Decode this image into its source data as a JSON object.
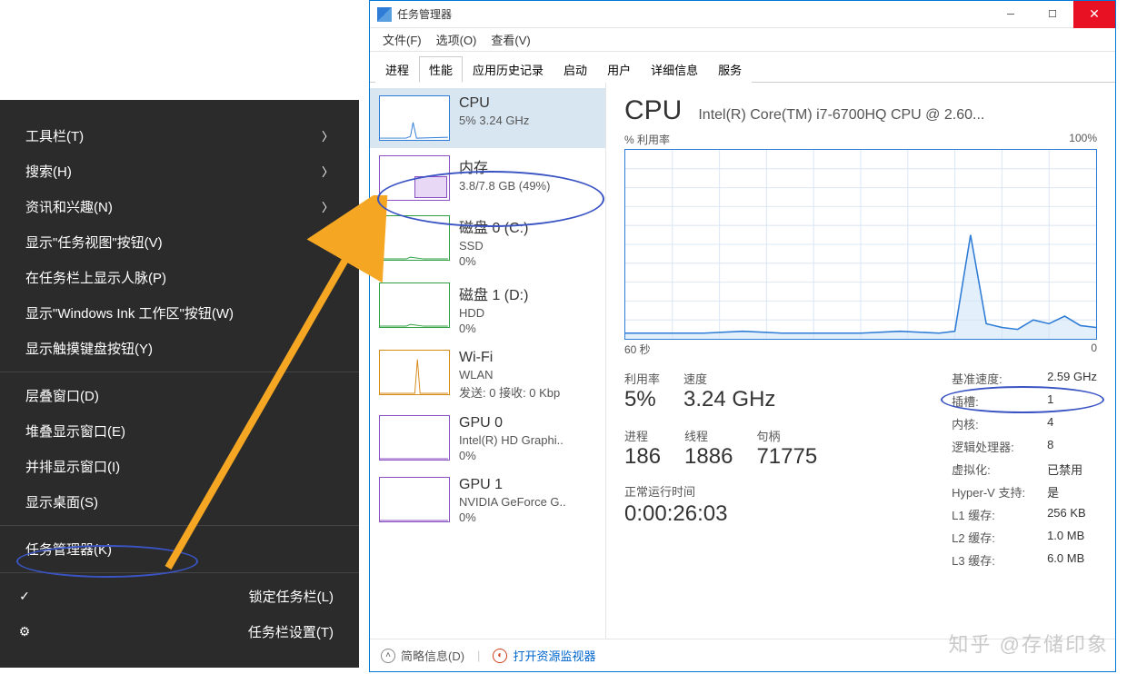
{
  "context_menu": {
    "items_group1": [
      {
        "label": "工具栏(T)",
        "arrow": true
      },
      {
        "label": "搜索(H)",
        "arrow": true
      },
      {
        "label": "资讯和兴趣(N)",
        "arrow": true
      },
      {
        "label": "显示\"任务视图\"按钮(V)",
        "arrow": false
      },
      {
        "label": "在任务栏上显示人脉(P)",
        "arrow": false
      },
      {
        "label": "显示\"Windows Ink 工作区\"按钮(W)",
        "arrow": false
      },
      {
        "label": "显示触摸键盘按钮(Y)",
        "arrow": false
      }
    ],
    "items_group2": [
      {
        "label": "层叠窗口(D)"
      },
      {
        "label": "堆叠显示窗口(E)"
      },
      {
        "label": "并排显示窗口(I)"
      },
      {
        "label": "显示桌面(S)"
      }
    ],
    "items_group3": [
      {
        "label": "任务管理器(K)"
      }
    ],
    "items_group4": [
      {
        "label": "锁定任务栏(L)",
        "icon": "✓"
      },
      {
        "label": "任务栏设置(T)",
        "icon": "⚙"
      }
    ]
  },
  "window": {
    "title": "任务管理器",
    "menus": [
      "文件(F)",
      "选项(O)",
      "查看(V)"
    ],
    "tabs": [
      "进程",
      "性能",
      "应用历史记录",
      "启动",
      "用户",
      "详细信息",
      "服务"
    ],
    "active_tab": 1,
    "footer": {
      "brief": "简略信息(D)",
      "resmon": "打开资源监视器"
    }
  },
  "sidebar": [
    {
      "title": "CPU",
      "sub": "5%  3.24 GHz",
      "type": "cpu"
    },
    {
      "title": "内存",
      "sub": "3.8/7.8 GB (49%)",
      "type": "mem"
    },
    {
      "title": "磁盘 0 (C:)",
      "sub": "SSD",
      "sub2": "0%",
      "type": "disk"
    },
    {
      "title": "磁盘 1 (D:)",
      "sub": "HDD",
      "sub2": "0%",
      "type": "disk"
    },
    {
      "title": "Wi-Fi",
      "sub": "WLAN",
      "sub2": "发送: 0 接收: 0 Kbp",
      "type": "wifi"
    },
    {
      "title": "GPU 0",
      "sub": "Intel(R) HD Graphi..",
      "sub2": "0%",
      "type": "gpu"
    },
    {
      "title": "GPU 1",
      "sub": "NVIDIA GeForce G..",
      "sub2": "0%",
      "type": "gpu"
    }
  ],
  "detail": {
    "title": "CPU",
    "subtitle": "Intel(R) Core(TM) i7-6700HQ CPU @ 2.60...",
    "chart_ylabel": "% 利用率",
    "chart_ymax": "100%",
    "chart_xlabel": "60 秒",
    "chart_xright": "0",
    "stats": {
      "util_label": "利用率",
      "util_val": "5%",
      "speed_label": "速度",
      "speed_val": "3.24 GHz",
      "proc_label": "进程",
      "proc_val": "186",
      "thread_label": "线程",
      "thread_val": "1886",
      "handle_label": "句柄",
      "handle_val": "71775",
      "uptime_label": "正常运行时间",
      "uptime_val": "0:00:26:03"
    },
    "specs": [
      {
        "k": "基准速度:",
        "v": "2.59 GHz"
      },
      {
        "k": "插槽:",
        "v": "1"
      },
      {
        "k": "内核:",
        "v": "4"
      },
      {
        "k": "逻辑处理器:",
        "v": "8"
      },
      {
        "k": "虚拟化:",
        "v": "已禁用"
      },
      {
        "k": "Hyper-V 支持:",
        "v": "是"
      },
      {
        "k": "L1 缓存:",
        "v": "256 KB"
      },
      {
        "k": "L2 缓存:",
        "v": "1.0 MB"
      },
      {
        "k": "L3 缓存:",
        "v": "6.0 MB"
      }
    ]
  },
  "chart_data": {
    "type": "line",
    "title": "% 利用率",
    "xlabel": "60 秒",
    "ylabel": "%",
    "ylim": [
      0,
      100
    ],
    "x": [
      60,
      55,
      50,
      45,
      40,
      35,
      30,
      25,
      20,
      18,
      16,
      14,
      12,
      10,
      8,
      6,
      4,
      2,
      0
    ],
    "values": [
      3,
      3,
      3,
      4,
      3,
      3,
      3,
      4,
      3,
      4,
      55,
      8,
      6,
      5,
      10,
      8,
      12,
      7,
      6
    ]
  },
  "watermark": "知乎 @存储印象"
}
